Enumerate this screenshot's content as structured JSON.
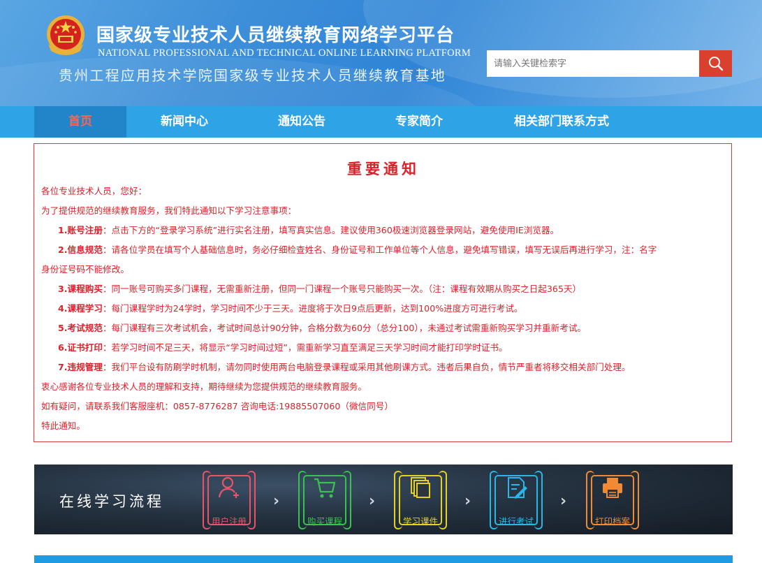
{
  "header": {
    "title": "国家级专业技术人员继续教育网络学习平台",
    "subtitle_en": "NATIONAL PROFESSIONAL AND TECHNICAL ONLINE LEARNING PLATFORM",
    "base_name": "贵州工程应用技术学院国家级专业技术人员继续教育基地",
    "search_placeholder": "请输入关键检索字",
    "emblem_icon": "national-emblem-icon",
    "search_icon": "search-icon"
  },
  "nav": {
    "items": [
      {
        "label": "首页",
        "active": true
      },
      {
        "label": "新闻中心",
        "active": false
      },
      {
        "label": "通知公告",
        "active": false
      },
      {
        "label": "专家简介",
        "active": false
      },
      {
        "label": "相关部门联系方式",
        "active": false
      }
    ]
  },
  "notice": {
    "title": "重要通知",
    "greeting": "各位专业技术人员，您好：",
    "intro": "为了提供规范的继续教育服务，我们特此通知以下学习注意事项：",
    "items": [
      {
        "label": "1.账号注册",
        "text": "：点击下方的“登录学习系统”进行实名注册，填写真实信息。建议使用360极速浏览器登录网站，避免使用IE浏览器。"
      },
      {
        "label": "2.信息规范",
        "text": "：请各位学员在填写个人基础信息时，务必仔细检查姓名、身份证号和工作单位等个人信息，避免填写错误，填写无误后再进行学习，注：名字",
        "cont": "身份证号码不能修改。"
      },
      {
        "label": "3.课程购买",
        "text": "：同一账号可购买多门课程，无需重新注册，但同一门课程一个账号只能购买一次。（注：课程有效期从购买之日起365天）"
      },
      {
        "label": "4.课程学习",
        "text": "：每门课程学时为24学时，学习时间不少于三天。进度将于次日9点后更新，达到100%进度方可进行考试。"
      },
      {
        "label": "5.考试规范",
        "text": "：每门课程有三次考试机会，考试时间总计90分钟，合格分数为60分（总分100），未通过考试需重新购买学习并重新考试。"
      },
      {
        "label": "6.证书打印",
        "text": "：若学习时间不足三天，将显示“学习时间过短”，需重新学习直至满足三天学习时间才能打印学时证书。"
      },
      {
        "label": "7.违规管理",
        "text": "：我们平台设有防刷学时机制，请勿同时使用两台电脑登录课程或采用其他刷课方式。违者后果自负，情节严重者将移交相关部门处理。"
      }
    ],
    "thanks": "衷心感谢各位专业技术人员的理解和支持，期待继续为您提供规范的继续教育服务。",
    "contact": "如有疑问，请联系我们客服座机：0857-8776287 咨询电话:19885507060（微信同号）",
    "closing": "特此通知。"
  },
  "process": {
    "title": "在线学习流程",
    "steps": [
      {
        "label": "用户注册",
        "icon": "user-add-icon",
        "color": "#e8556a"
      },
      {
        "label": "购买课程",
        "icon": "shopping-cart-icon",
        "color": "#39c24f"
      },
      {
        "label": "学习课件",
        "icon": "courseware-stack-icon",
        "color": "#e4d21d"
      },
      {
        "label": "进行考试",
        "icon": "exam-edit-icon",
        "color": "#27b8e8"
      },
      {
        "label": "打印档案",
        "icon": "printer-icon",
        "color": "#f08a34"
      }
    ],
    "arrow_glyph": "›"
  },
  "colors": {
    "header_blue": "#2f84d6",
    "nav_blue": "#2ea3e6",
    "nav_active": "#2385c9",
    "accent_red": "#d9222a",
    "search_red": "#d9402e"
  }
}
